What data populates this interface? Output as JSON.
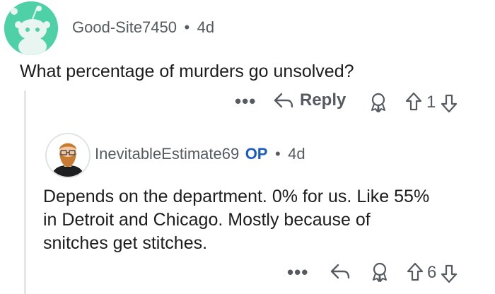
{
  "comment1": {
    "author": "Good-Site7450",
    "separator": "•",
    "time": "4d",
    "body": "What percentage of murders go unsolved?",
    "actions": {
      "more": "•••",
      "reply_label": "Reply",
      "score": "1"
    }
  },
  "comment2": {
    "author": "InevitableEstimate69",
    "op_badge": "OP",
    "separator": "•",
    "time": "4d",
    "body_lines": [
      "Depends on the department. 0% for us. Like 55%",
      "in Detroit and Chicago. Mostly because of",
      "snitches get stitches."
    ],
    "actions": {
      "more": "•••",
      "score": "6"
    }
  },
  "icons": {
    "avatar1": "snoo-avatar-icon",
    "avatar2": "bearded-man-avatar-icon",
    "reply": "reply-arrow-icon",
    "award": "award-icon",
    "upvote": "upvote-arrow-icon",
    "downvote": "downvote-arrow-icon"
  },
  "colors": {
    "snoo_bg": "#4fd1a8",
    "op_blue": "#1a5bc4",
    "meta_gray": "#555b61",
    "thread_line": "#e3e6e8"
  }
}
